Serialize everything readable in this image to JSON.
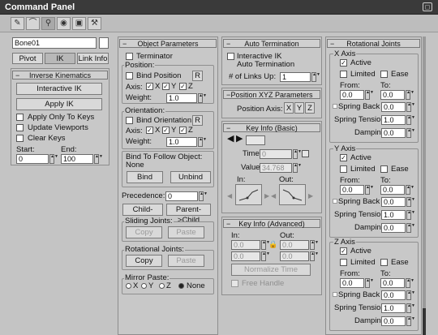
{
  "window": {
    "title": "Command Panel"
  },
  "object_name": "Bone01",
  "tabs": {
    "pivot": "Pivot",
    "ik": "IK",
    "link_info": "Link Info"
  },
  "ik": {
    "rollout": "Inverse Kinematics",
    "interactive_ik": "Interactive IK",
    "apply_ik": "Apply IK",
    "apply_only_to_keys": "Apply Only To Keys",
    "update_viewports": "Update Viewports",
    "clear_keys": "Clear Keys",
    "start_label": "Start:",
    "end_label": "End:",
    "start_value": "0",
    "end_value": "100"
  },
  "obj": {
    "rollout": "Object Parameters",
    "terminator": "Terminator",
    "position": "Position:",
    "bind_position": "Bind Position",
    "r": "R",
    "axis": "Axis:",
    "x": "X",
    "y": "Y",
    "z": "Z",
    "weight": "Weight:",
    "weight_value": "1.0",
    "orientation": "Orientation:",
    "bind_orientation": "Bind Orientation",
    "bind_follow": "Bind To Follow Object:",
    "none": "None",
    "bind": "Bind",
    "unbind": "Unbind",
    "precedence": "Precedence:",
    "precedence_value": "0",
    "child_parent": "Child->Parent",
    "parent_child": "Parent->Child",
    "sliding": "Sliding Joints:",
    "copy": "Copy",
    "paste": "Paste",
    "rotational": "Rotational Joints:",
    "mirror": "Mirror Paste:",
    "mx": "X",
    "my": "Y",
    "mz": "Z",
    "mnone": "None"
  },
  "auto": {
    "rollout": "Auto Termination",
    "interactive_ik": "Interactive IK",
    "auto_term": "Auto Termination",
    "links_up": "# of Links Up:",
    "links_up_value": "1"
  },
  "posxyz": {
    "rollout": "Position XYZ Parameters",
    "axis": "Position Axis:",
    "x": "X",
    "y": "Y",
    "z": "Z"
  },
  "keyinfo": {
    "rollout": "Key Info (Basic)",
    "time": "Time:",
    "time_value": "0",
    "value": "Value:",
    "value_value": "34.768",
    "in": "In:",
    "out": "Out:"
  },
  "keyadv": {
    "rollout": "Key Info (Advanced)",
    "in": "In:",
    "out": "Out:",
    "v1": "0.0",
    "v2": "0.0",
    "v3": "0.0",
    "v4": "0.0",
    "normalize": "Normalize Time",
    "free_handle": "Free Handle"
  },
  "rot": {
    "rollout": "Rotational Joints",
    "axes": [
      {
        "title": "X Axis",
        "active": "Active",
        "limited": "Limited",
        "ease": "Ease",
        "from": "From:",
        "to": "To:",
        "from_v": "0.0",
        "to_v": "0.0",
        "spring_back": "Spring Back",
        "spring_back_v": "0.0",
        "spring_tension": "Spring Tension:",
        "spring_tension_v": "1.0",
        "damping": "Damping:",
        "damping_v": "0.0"
      },
      {
        "title": "Y Axis",
        "active": "Active",
        "limited": "Limited",
        "ease": "Ease",
        "from": "From:",
        "to": "To:",
        "from_v": "0.0",
        "to_v": "0.0",
        "spring_back": "Spring Back",
        "spring_back_v": "0.0",
        "spring_tension": "Spring Tension:",
        "spring_tension_v": "1.0",
        "damping": "Damping:",
        "damping_v": "0.0"
      },
      {
        "title": "Z Axis",
        "active": "Active",
        "limited": "Limited",
        "ease": "Ease",
        "from": "From:",
        "to": "To:",
        "from_v": "0.0",
        "to_v": "0.0",
        "spring_back": "Spring Back",
        "spring_back_v": "0.0",
        "spring_tension": "Spring Tension:",
        "spring_tension_v": "1.0",
        "damping": "Damping:",
        "damping_v": "0.0"
      }
    ]
  }
}
